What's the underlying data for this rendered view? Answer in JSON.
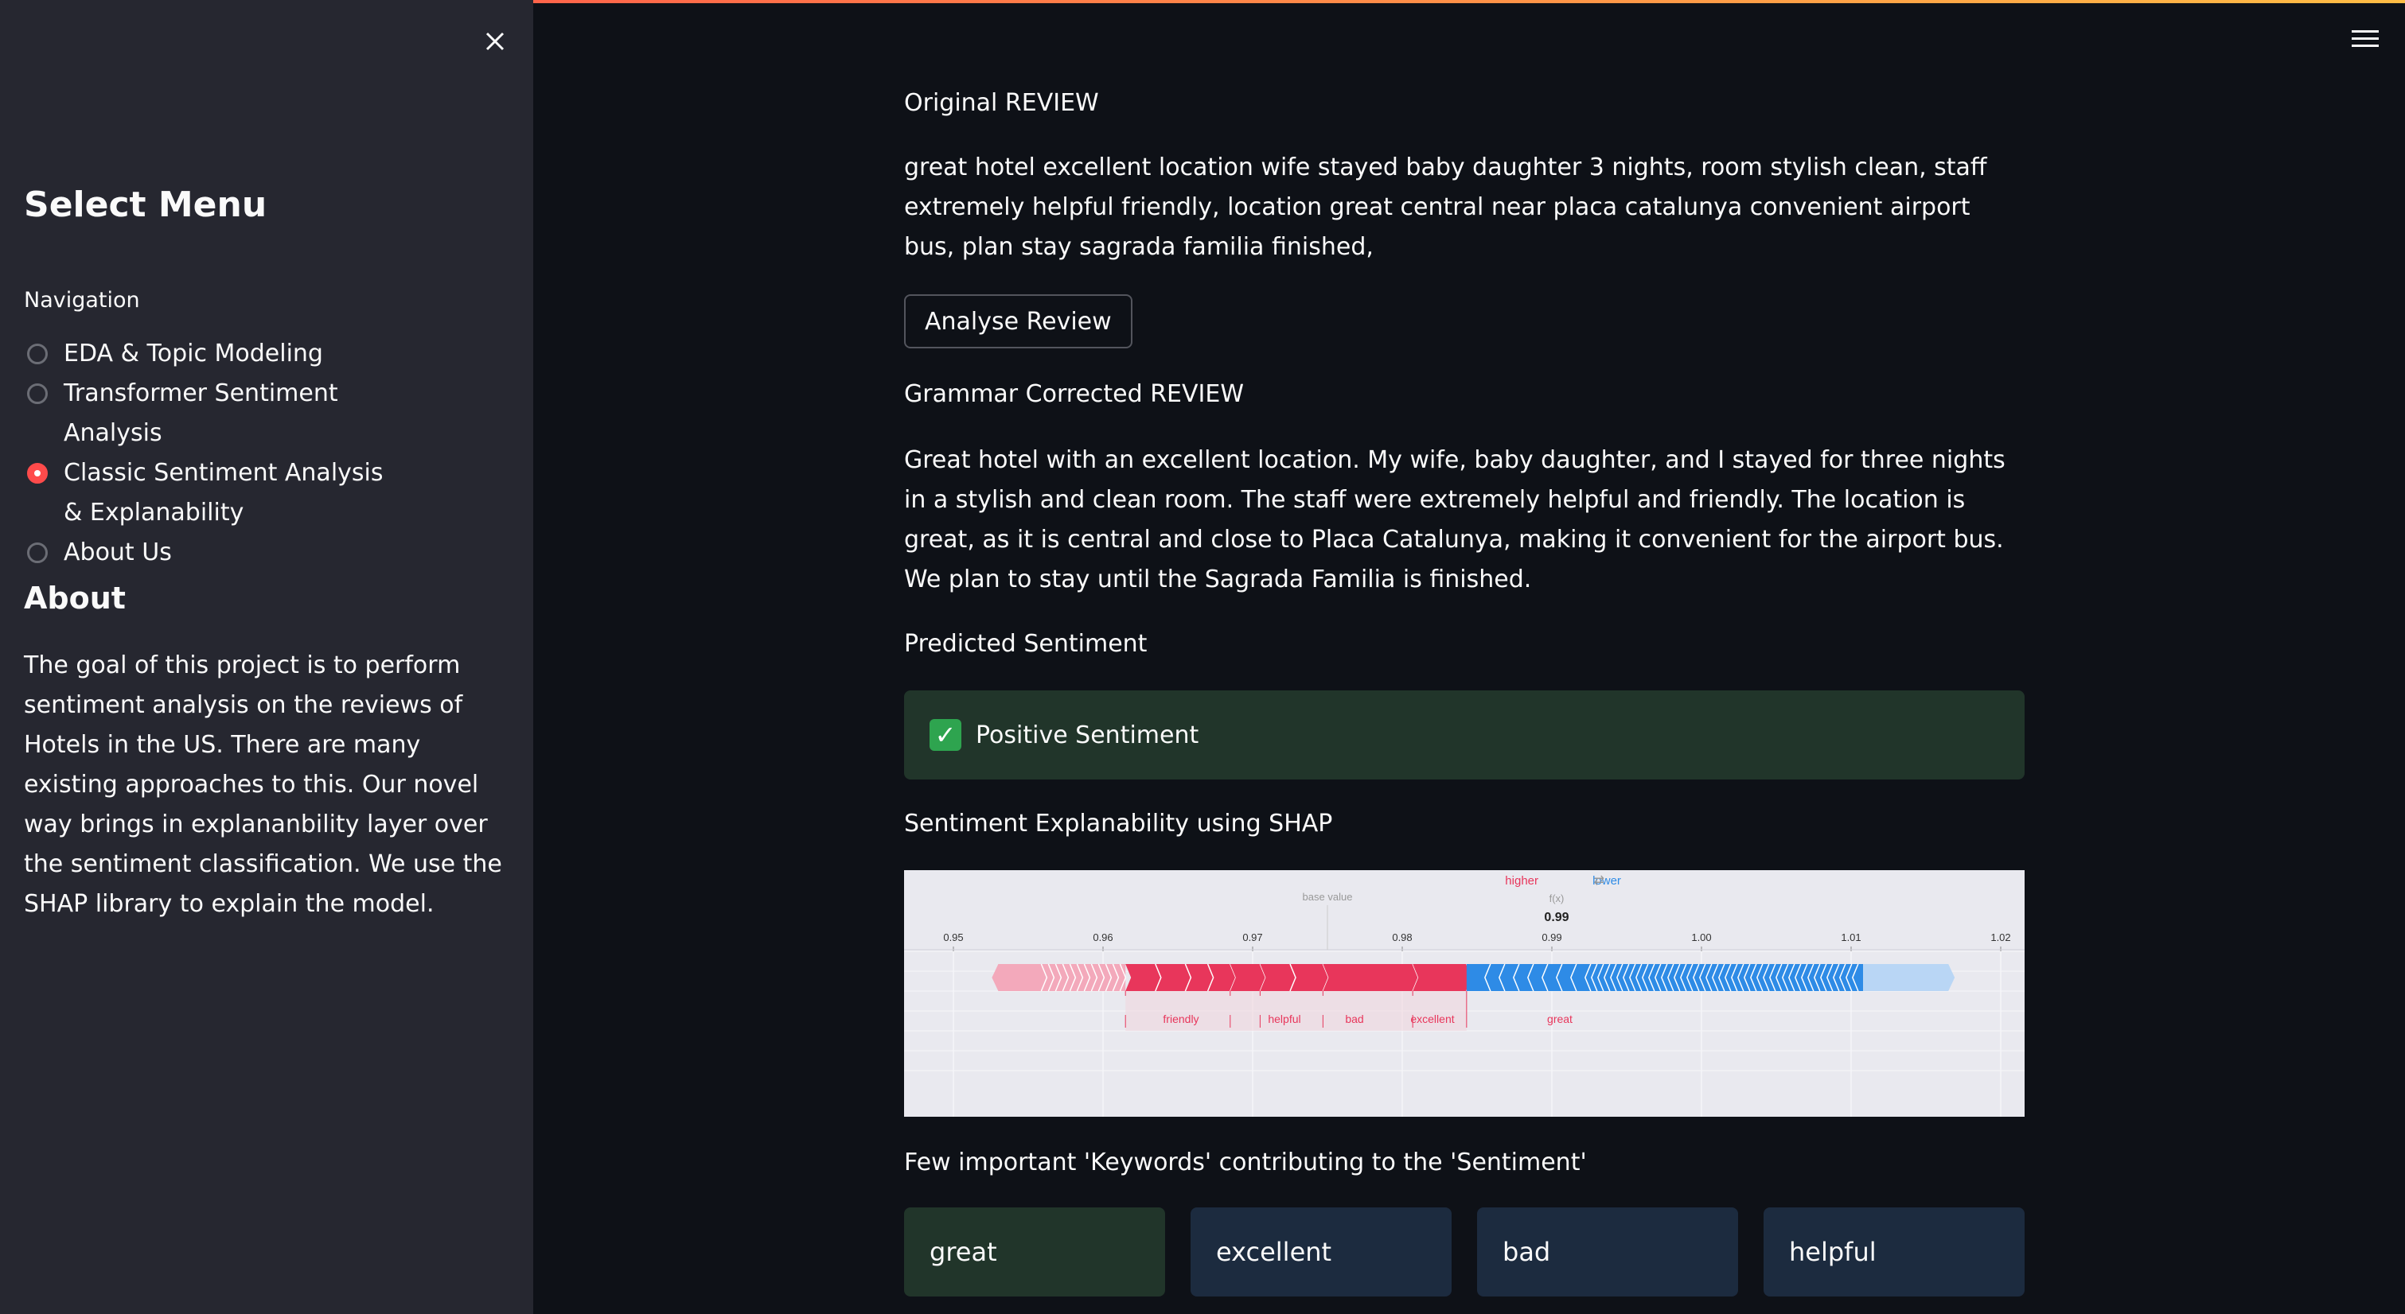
{
  "sidebar": {
    "title": "Select Menu",
    "nav_label": "Navigation",
    "items": [
      {
        "label": "EDA & Topic Modeling",
        "selected": false
      },
      {
        "label": "Transformer Sentiment Analysis",
        "selected": false
      },
      {
        "label": "Classic Sentiment Analysis & Explanability",
        "selected": true
      },
      {
        "label": "About Us",
        "selected": false
      }
    ],
    "about_title": "About",
    "about_text": "The goal of this project is to perform sentiment analysis on the reviews of Hotels in the US. There are many existing approaches to this. Our novel way brings in explananbility layer over the sentiment classification. We use the SHAP library to explain the model."
  },
  "main": {
    "original_label": "Original REVIEW",
    "original_text": "great hotel excellent location wife stayed baby daughter 3 nights, room stylish clean, staff extremely helpful friendly, location great central near placa catalunya convenient airport bus, plan stay sagrada familia finished,",
    "analyse_button": "Analyse Review",
    "corrected_label": "Grammar Corrected REVIEW",
    "corrected_text": "Great hotel with an excellent location. My wife, baby daughter, and I stayed for three nights in a stylish and clean room. The staff were extremely helpful and friendly. The location is great, as it is central and close to Placa Catalunya, making it convenient for the airport bus. We plan to stay until the Sagrada Familia is finished.",
    "predicted_label": "Predicted Sentiment",
    "predicted_value": "Positive Sentiment",
    "shap_label": "Sentiment Explanability using SHAP",
    "keywords_label": "Few important 'Keywords' contributing to the 'Sentiment'",
    "keywords": [
      {
        "word": "great",
        "color": "#21352a"
      },
      {
        "word": "excellent",
        "color": "#1c2b3f"
      },
      {
        "word": "bad",
        "color": "#1c2b3f"
      },
      {
        "word": "helpful",
        "color": "#1c2b3f"
      }
    ]
  },
  "shap_plot": {
    "higher": "higher",
    "arrows": "⇄",
    "lower": "lower",
    "base_value_label": "base value",
    "fx_label": "f(x)",
    "fx_value": "0.99",
    "ticks": [
      "0.95",
      "0.96",
      "0.97",
      "0.98",
      "0.99",
      "1.00",
      "1.01",
      "1.02"
    ],
    "features": [
      "friendly",
      "helpful",
      "bad",
      "excellent",
      "great"
    ]
  },
  "chart_data": {
    "type": "force",
    "base_value": 0.975,
    "output_value": 0.99,
    "xlim": [
      0.95,
      1.02
    ],
    "ticks": [
      0.95,
      0.96,
      0.97,
      0.98,
      0.99,
      1.0,
      1.01,
      1.02
    ],
    "positive_features": [
      {
        "name": "friendly",
        "from": 0.9615,
        "to": 0.9685
      },
      {
        "name": "helpful",
        "from": 0.9685,
        "to": 0.9705
      },
      {
        "name": "bad",
        "from": 0.9705,
        "to": 0.9747
      },
      {
        "name": "excellent",
        "from": 0.9747,
        "to": 0.9807
      },
      {
        "name": "great",
        "from": 0.9807,
        "to": 0.9843
      }
    ],
    "positive_start": 0.953,
    "negative_end": 1.0165,
    "colors": {
      "positive": "#e8365b",
      "negative": "#2e8be6"
    }
  },
  "colors": {
    "accent": "#ff4b4b",
    "success_bg": "#21352a",
    "info_bg": "#1c2b3f"
  },
  "icons": {
    "close": "close-icon",
    "menu": "hamburger-menu-icon",
    "check": "check-mark-icon"
  }
}
